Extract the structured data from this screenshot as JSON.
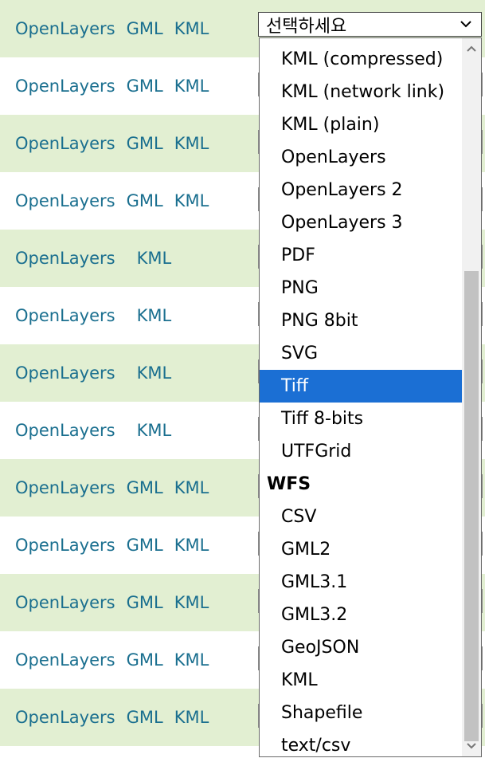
{
  "rows": [
    {
      "links": [
        "OpenLayers",
        "GML",
        "KML"
      ]
    },
    {
      "links": [
        "OpenLayers",
        "GML",
        "KML"
      ]
    },
    {
      "links": [
        "OpenLayers",
        "GML",
        "KML"
      ]
    },
    {
      "links": [
        "OpenLayers",
        "GML",
        "KML"
      ]
    },
    {
      "links": [
        "OpenLayers",
        "",
        "KML"
      ]
    },
    {
      "links": [
        "OpenLayers",
        "",
        "KML"
      ]
    },
    {
      "links": [
        "OpenLayers",
        "",
        "KML"
      ]
    },
    {
      "links": [
        "OpenLayers",
        "",
        "KML"
      ]
    },
    {
      "links": [
        "OpenLayers",
        "GML",
        "KML"
      ]
    },
    {
      "links": [
        "OpenLayers",
        "GML",
        "KML"
      ]
    },
    {
      "links": [
        "OpenLayers",
        "GML",
        "KML"
      ]
    },
    {
      "links": [
        "OpenLayers",
        "GML",
        "KML"
      ]
    },
    {
      "links": [
        "OpenLayers",
        "GML",
        "KML"
      ]
    }
  ],
  "select": {
    "placeholder": "선택하세요",
    "options": [
      {
        "label": "KML (compressed)",
        "type": "option"
      },
      {
        "label": "KML (network link)",
        "type": "option"
      },
      {
        "label": "KML (plain)",
        "type": "option"
      },
      {
        "label": "OpenLayers",
        "type": "option"
      },
      {
        "label": "OpenLayers 2",
        "type": "option"
      },
      {
        "label": "OpenLayers 3",
        "type": "option"
      },
      {
        "label": "PDF",
        "type": "option"
      },
      {
        "label": "PNG",
        "type": "option"
      },
      {
        "label": "PNG 8bit",
        "type": "option"
      },
      {
        "label": "SVG",
        "type": "option"
      },
      {
        "label": "Tiff",
        "type": "option",
        "selected": true
      },
      {
        "label": "Tiff 8-bits",
        "type": "option"
      },
      {
        "label": "UTFGrid",
        "type": "option"
      },
      {
        "label": "WFS",
        "type": "group"
      },
      {
        "label": "CSV",
        "type": "option"
      },
      {
        "label": "GML2",
        "type": "option"
      },
      {
        "label": "GML3.1",
        "type": "option"
      },
      {
        "label": "GML3.2",
        "type": "option"
      },
      {
        "label": "GeoJSON",
        "type": "option"
      },
      {
        "label": "KML",
        "type": "option"
      },
      {
        "label": "Shapefile",
        "type": "option"
      },
      {
        "label": "text/csv",
        "type": "option"
      }
    ]
  },
  "colors": {
    "row_alt_bg": "#e2efd2",
    "link": "#1a6f8f",
    "selected_bg": "#1b6fd4"
  }
}
